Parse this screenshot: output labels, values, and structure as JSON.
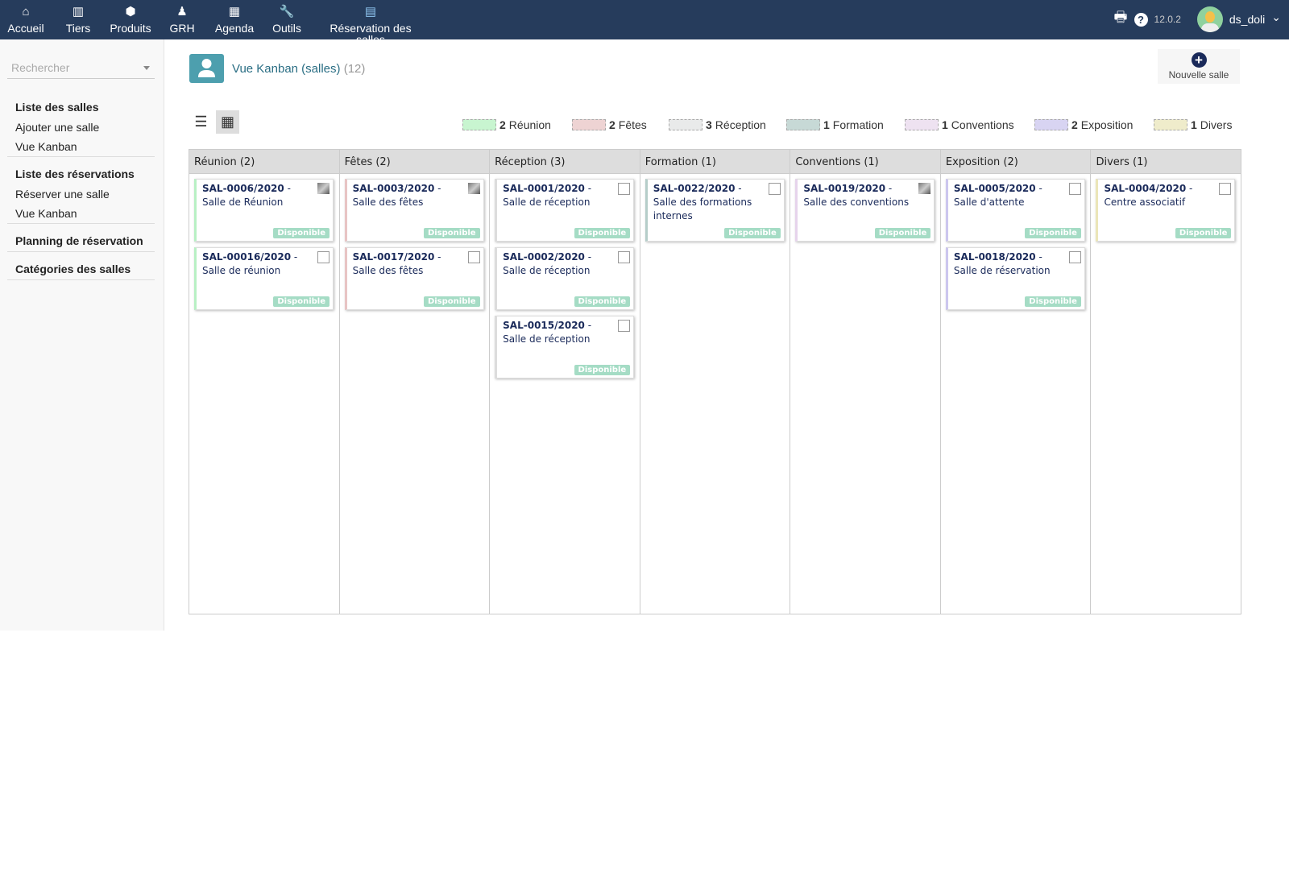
{
  "topnav": {
    "items": [
      {
        "label": "Accueil",
        "icon": "home-icon",
        "glyph": "⌂"
      },
      {
        "label": "Tiers",
        "icon": "building-icon",
        "glyph": "▥"
      },
      {
        "label": "Produits",
        "icon": "cube-icon",
        "glyph": "⬢"
      },
      {
        "label": "GRH",
        "icon": "user-tie-icon",
        "glyph": "♟"
      },
      {
        "label": "Agenda",
        "icon": "calendar-icon",
        "glyph": "▦"
      },
      {
        "label": "Outils",
        "icon": "wrench-icon",
        "glyph": "🔧"
      },
      {
        "label": "Réservation des salles",
        "icon": "room-booking-icon",
        "glyph": "▤"
      }
    ],
    "version": "12.0.2",
    "user": "ds_doli"
  },
  "sidebar": {
    "search_placeholder": "Rechercher",
    "groups": [
      {
        "header": "Liste des salles",
        "items": [
          "Ajouter une salle",
          "Vue Kanban"
        ]
      },
      {
        "header": "Liste des réservations",
        "items": [
          "Réserver une salle",
          "Vue Kanban"
        ]
      },
      {
        "header": "Planning de réservation",
        "items": []
      },
      {
        "header": "Catégories des salles",
        "items": []
      }
    ]
  },
  "page": {
    "title": "Vue Kanban (salles)",
    "count": "(12)",
    "new_button": "Nouvelle salle"
  },
  "legend": [
    {
      "count": "2",
      "label": "Réunion",
      "color": "#c8f5d0"
    },
    {
      "count": "2",
      "label": "Fêtes",
      "color": "#eed3d3"
    },
    {
      "count": "3",
      "label": "Réception",
      "color": "#e9eaea"
    },
    {
      "count": "1",
      "label": "Formation",
      "color": "#c7d9d6"
    },
    {
      "count": "1",
      "label": "Conventions",
      "color": "#eee2f1"
    },
    {
      "count": "2",
      "label": "Exposition",
      "color": "#d8d4f2"
    },
    {
      "count": "1",
      "label": "Divers",
      "color": "#efeccb"
    }
  ],
  "columns": [
    {
      "title": "Réunion (2)",
      "color": "#b8f0c4",
      "cards": [
        {
          "ref": "SAL-0006/2020",
          "name": " - Salle de Réunion",
          "status": "Disponible",
          "thumb": true
        },
        {
          "ref": "SAL-00016/2020",
          "name": " - Salle de réunion",
          "status": "Disponible"
        }
      ]
    },
    {
      "title": "Fêtes (2)",
      "color": "#e8c4c4",
      "cards": [
        {
          "ref": "SAL-0003/2020",
          "name": " - Salle des fêtes",
          "status": "Disponible",
          "thumb": true
        },
        {
          "ref": "SAL-0017/2020",
          "name": " - Salle des fêtes",
          "status": "Disponible"
        }
      ]
    },
    {
      "title": "Réception (3)",
      "color": "#dcdcdc",
      "cards": [
        {
          "ref": "SAL-0001/2020",
          "name": " - Salle de réception",
          "status": "Disponible"
        },
        {
          "ref": "SAL-0002/2020",
          "name": " - Salle de réception",
          "status": "Disponible"
        },
        {
          "ref": "SAL-0015/2020",
          "name": " - Salle de réception",
          "status": "Disponible"
        }
      ]
    },
    {
      "title": "Formation (1)",
      "color": "#b5cdc9",
      "cards": [
        {
          "ref": "SAL-0022/2020",
          "name": " - Salle des formations internes",
          "status": "Disponible"
        }
      ]
    },
    {
      "title": "Conventions (1)",
      "color": "#e6d4ec",
      "cards": [
        {
          "ref": "SAL-0019/2020",
          "name": " - Salle des conventions",
          "status": "Disponible",
          "thumb": true
        }
      ]
    },
    {
      "title": "Exposition (2)",
      "color": "#ccc6ee",
      "cards": [
        {
          "ref": "SAL-0005/2020",
          "name": " - Salle d'attente",
          "status": "Disponible"
        },
        {
          "ref": "SAL-0018/2020",
          "name": " - Salle de réservation",
          "status": "Disponible"
        }
      ]
    },
    {
      "title": "Divers (1)",
      "color": "#ebe6b8",
      "cards": [
        {
          "ref": "SAL-0004/2020",
          "name": " - Centre associatif",
          "status": "Disponible"
        }
      ]
    }
  ]
}
